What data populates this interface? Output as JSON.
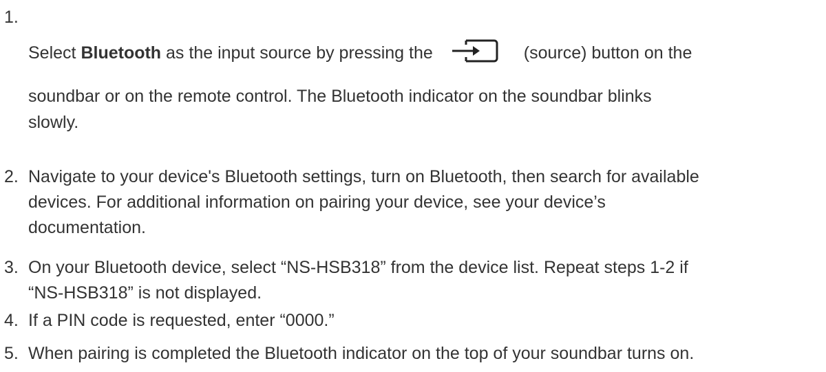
{
  "steps": [
    {
      "number": "1.",
      "text_before_bold": "Select ",
      "bold": "Bluetooth",
      "text_after_bold": " as the input source by pressing the",
      "icon": "source-input-icon",
      "text_after_icon": "(source) button on the",
      "line2": "soundbar or on the remote control. The Bluetooth indicator on the soundbar blinks",
      "line3": "slowly."
    },
    {
      "number": "2.",
      "line1": "Navigate to your device's Bluetooth settings, turn on Bluetooth, then search for available",
      "line2": "devices. For additional information on pairing your device, see your device’s",
      "line3": "documentation."
    },
    {
      "number": "3.",
      "line1": "On your Bluetooth device, select “NS-HSB318” from the device list. Repeat steps 1-2 if",
      "line2": "“NS-HSB318” is not displayed."
    },
    {
      "number": "4.",
      "line1": "If a PIN code is requested, enter “0000.”"
    },
    {
      "number": "5.",
      "line1": "When pairing is completed the Bluetooth indicator on the top of your soundbar turns on."
    }
  ]
}
